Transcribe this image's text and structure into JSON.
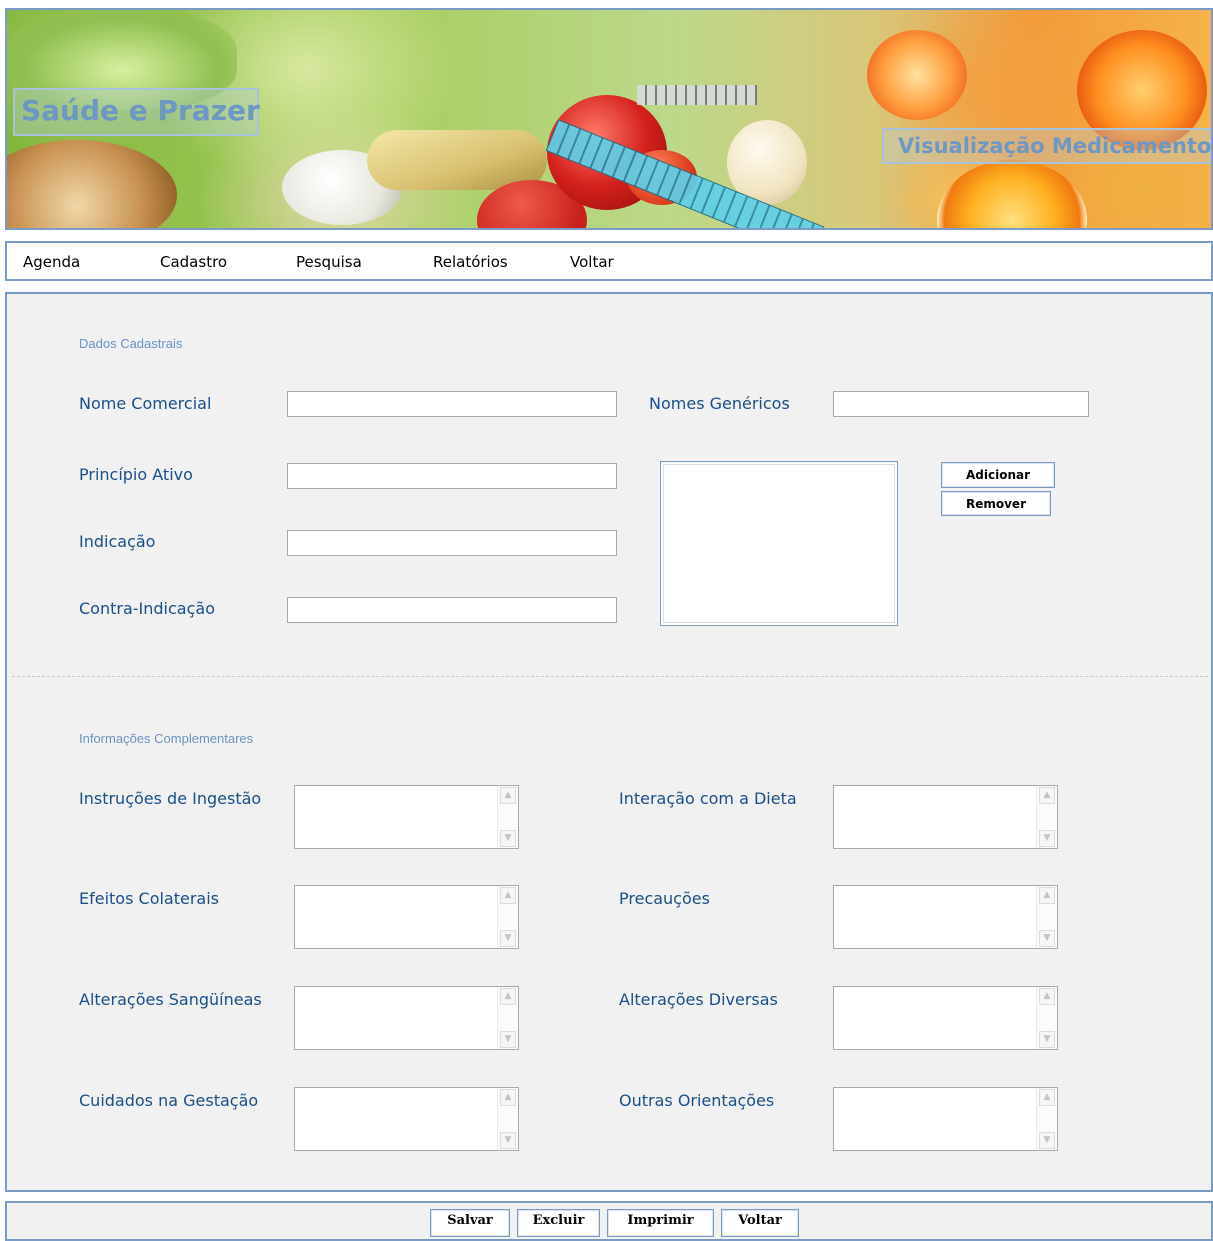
{
  "banner": {
    "site_title": "Saúde e Prazer",
    "page_heading": "Visualização Medicamentos"
  },
  "nav": {
    "items": [
      "Agenda",
      "Cadastro",
      "Pesquisa",
      "Relatórios",
      "Voltar"
    ]
  },
  "dados_cadastrais": {
    "section_title": "Dados Cadastrais",
    "nome_comercial": {
      "label": "Nome Comercial",
      "value": ""
    },
    "principio_ativo": {
      "label": "Princípio Ativo",
      "value": ""
    },
    "indicacao": {
      "label": "Indicação",
      "value": ""
    },
    "contra_indicacao": {
      "label": "Contra-Indicação",
      "value": ""
    },
    "nomes_genericos": {
      "label": "Nomes Genéricos",
      "value": "",
      "list": []
    },
    "add_label": "Adicionar",
    "remove_label": "Remover"
  },
  "info_complementares": {
    "section_title": "Informações Complementares",
    "fields": {
      "instrucoes": "Instruções de Ingestão",
      "interacao": "Interação com a Dieta",
      "efeitos": "Efeitos Colaterais",
      "precaucoes": "Precauções",
      "alteracoes_sang": "Alterações Sangüíneas",
      "alteracoes_div": "Alterações Diversas",
      "gestacao": "Cuidados na Gestação",
      "outras": "Outras Orientações"
    }
  },
  "footer": {
    "salvar": "Salvar",
    "excluir": "Excluir",
    "imprimir": "Imprimir",
    "voltar": "Voltar"
  },
  "colors": {
    "border": "#7a9cc4",
    "label": "#1a4f8a",
    "section_title": "#6a92c4",
    "panel_bg": "#f1f1f1",
    "banner_text": "#6d97c4"
  }
}
